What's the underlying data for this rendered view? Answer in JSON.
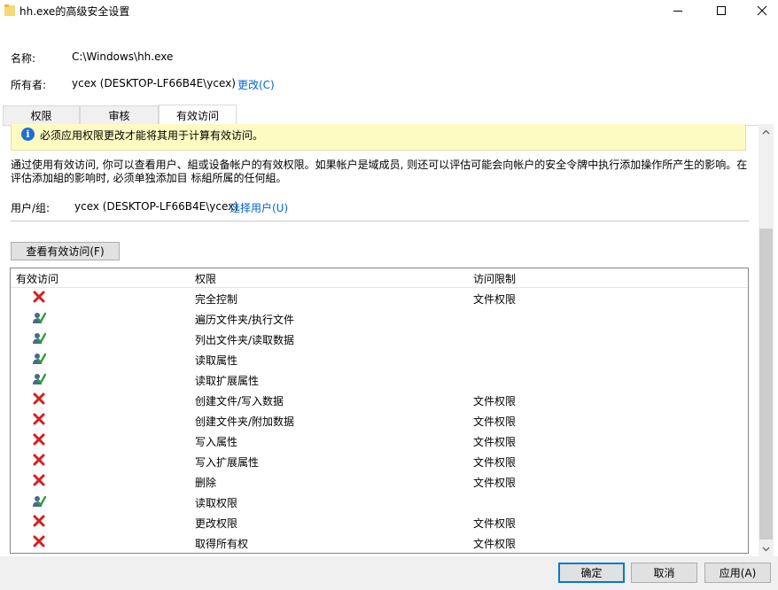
{
  "window": {
    "title": "hh.exe的高级安全设置"
  },
  "props": {
    "name_label": "名称:",
    "name_value": "C:\\Windows\\hh.exe",
    "owner_label": "所有者:",
    "owner_value": "ycex (DESKTOP-LF66B4E\\ycex)",
    "owner_change": "更改(C)"
  },
  "tabs": [
    {
      "label": "权限",
      "active": false
    },
    {
      "label": "审核",
      "active": false
    },
    {
      "label": "有效访问",
      "active": true
    }
  ],
  "info_message": "必须应用权限更改才能将其用于计算有效访问。",
  "description": "通过使用有效访问, 你可以查看用户、組或设备帐户的有效权限。如果帐户是域成员, 则还可以评估可能会向帐户的安全令牌中执行添加操作所产生的影响。在评估添加組的影响时, 必须单独添加目 标組所属的任何組。",
  "user_group": {
    "label": "用户/组:",
    "value": "ycex (DESKTOP-LF66B4E\\ycex)",
    "select_link": "选择用户(U)"
  },
  "view_button": "查看有效访问(F)",
  "table": {
    "columns": [
      "有效访问",
      "权限",
      "访问限制"
    ],
    "rows": [
      {
        "status": "denied",
        "permission": "完全控制",
        "limit": "文件权限"
      },
      {
        "status": "allowed",
        "permission": "遍历文件夹/执行文件",
        "limit": ""
      },
      {
        "status": "allowed",
        "permission": "列出文件夹/读取数据",
        "limit": ""
      },
      {
        "status": "allowed",
        "permission": "读取属性",
        "limit": ""
      },
      {
        "status": "allowed",
        "permission": "读取扩展属性",
        "limit": ""
      },
      {
        "status": "denied",
        "permission": "创建文件/写入数据",
        "limit": "文件权限"
      },
      {
        "status": "denied",
        "permission": "创建文件夹/附加数据",
        "limit": "文件权限"
      },
      {
        "status": "denied",
        "permission": "写入属性",
        "limit": "文件权限"
      },
      {
        "status": "denied",
        "permission": "写入扩展属性",
        "limit": "文件权限"
      },
      {
        "status": "denied",
        "permission": "删除",
        "limit": "文件权限"
      },
      {
        "status": "allowed",
        "permission": "读取权限",
        "limit": ""
      },
      {
        "status": "denied",
        "permission": "更改权限",
        "limit": "文件权限"
      },
      {
        "status": "denied",
        "permission": "取得所有权",
        "limit": "文件权限"
      }
    ]
  },
  "buttons": {
    "ok": "确定",
    "cancel": "取消",
    "apply": "应用(A)"
  },
  "colors": {
    "link": "#0066cc",
    "info_bg": "#fefbc2",
    "deny_red": "#d81e1e",
    "allow_green": "#2e9e3e",
    "accent": "#0078d7"
  }
}
